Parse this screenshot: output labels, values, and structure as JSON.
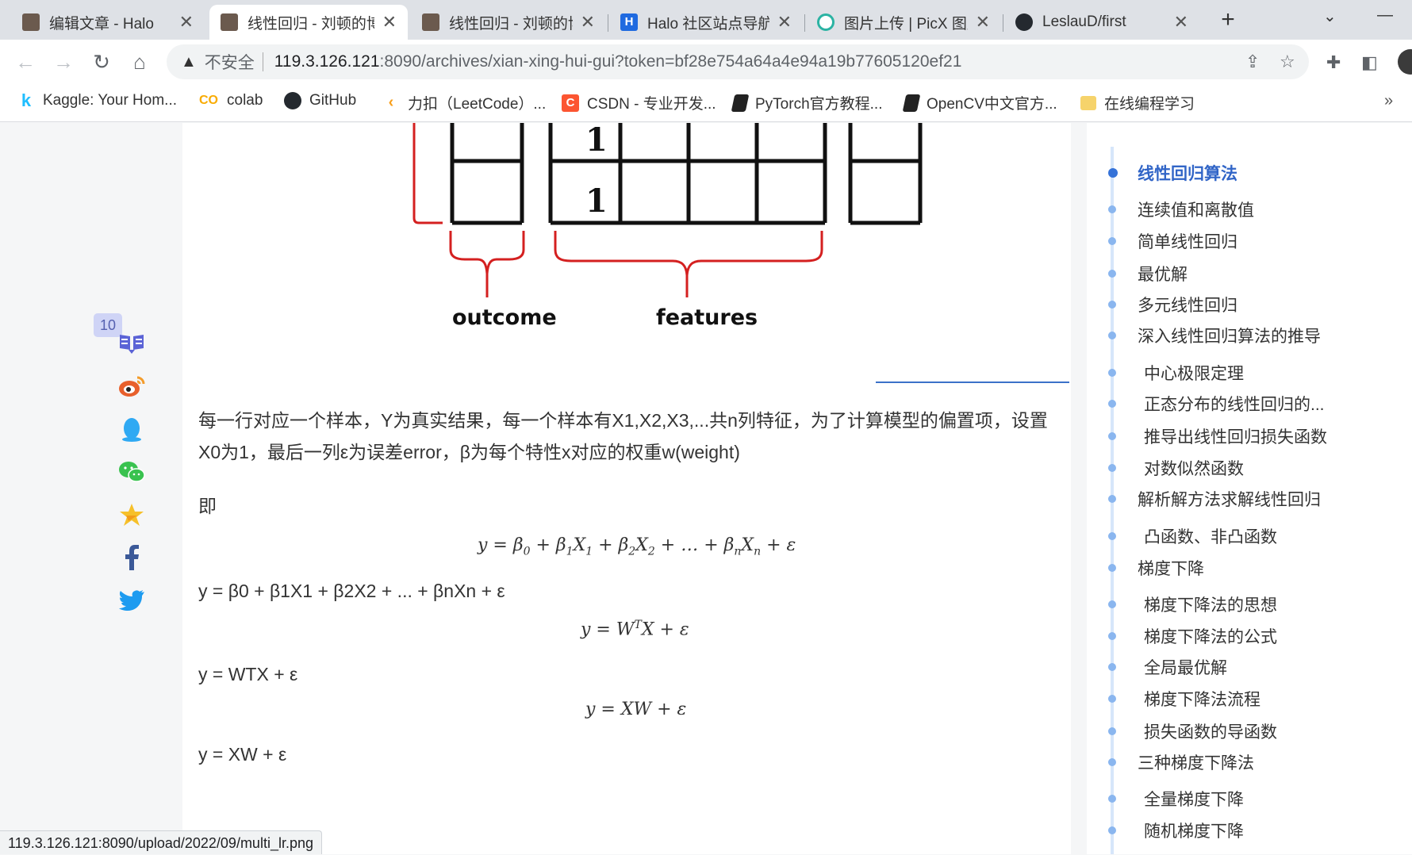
{
  "browser": {
    "tabs": [
      {
        "title": "编辑文章 - Halo"
      },
      {
        "title": "线性回归 - 刘顿的博"
      },
      {
        "title": "线性回归 - 刘顿的博"
      },
      {
        "title": "Halo 社区站点导航"
      },
      {
        "title": "图片上传 | PicX 图床"
      },
      {
        "title": "LeslauD/first"
      }
    ],
    "security_label": "不安全",
    "url_host": "119.3.126.121",
    "url_rest": ":8090/archives/xian-xing-hui-gui?token=bf28e754a64a4e94a19b77605120ef21",
    "bookmarks": [
      {
        "label": "Kaggle: Your Hom..."
      },
      {
        "label": "colab"
      },
      {
        "label": "GitHub"
      },
      {
        "label": "力扣（LeetCode）..."
      },
      {
        "label": "CSDN - 专业开发..."
      },
      {
        "label": "PyTorch官方教程..."
      },
      {
        "label": "OpenCV中文官方..."
      },
      {
        "label": "在线编程学习"
      }
    ],
    "bookmarks_overflow": "»",
    "status_url": "119.3.126.121:8090/upload/2022/09/multi_lr.png"
  },
  "share": {
    "comment_count": "10",
    "icons": [
      "comment-icon",
      "weibo-icon",
      "qq-icon",
      "wechat-icon",
      "qzone-icon",
      "facebook-icon",
      "twitter-icon"
    ]
  },
  "figure": {
    "cells": [
      "1",
      "1"
    ],
    "outcome_label": "outcome",
    "features_label": "features"
  },
  "article": {
    "para1_line1": "每一行对应一个样本，Y为真实结果，每一个样本有X1,X2,X3,...共n列特征，为了计算模型的偏置项，设置",
    "para1_line2": "X0为1，最后一列ε为误差error，β为每个特性x对应的权重w(weight)",
    "para2": "即",
    "formula1_alt": "y = β0 + β1X1 + β2X2 + ... + βnXn + ε",
    "formula2_alt": "y = WTX + ε",
    "formula3_alt": "y = XW + ε"
  },
  "toc": {
    "items": [
      {
        "label": "线性回归算法",
        "level": 0
      },
      {
        "label": "连续值和离散值",
        "level": 1
      },
      {
        "label": "简单线性回归",
        "level": 1
      },
      {
        "label": "最优解",
        "level": 1
      },
      {
        "label": "多元线性回归",
        "level": 1
      },
      {
        "label": "深入线性回归算法的推导",
        "level": 1
      },
      {
        "label": "中心极限定理",
        "level": 2
      },
      {
        "label": "正态分布的线性回归的...",
        "level": 2
      },
      {
        "label": "推导出线性回归损失函数",
        "level": 2
      },
      {
        "label": "对数似然函数",
        "level": 2
      },
      {
        "label": "解析解方法求解线性回归",
        "level": 1
      },
      {
        "label": "凸函数、非凸函数",
        "level": 2
      },
      {
        "label": "梯度下降",
        "level": 1
      },
      {
        "label": "梯度下降法的思想",
        "level": 2
      },
      {
        "label": "梯度下降法的公式",
        "level": 2
      },
      {
        "label": "全局最优解",
        "level": 2
      },
      {
        "label": "梯度下降法流程",
        "level": 2
      },
      {
        "label": "损失函数的导函数",
        "level": 2
      },
      {
        "label": "三种梯度下降法",
        "level": 1
      },
      {
        "label": "全量梯度下降",
        "level": 2
      },
      {
        "label": "随机梯度下降",
        "level": 2
      }
    ]
  },
  "colors": {
    "accent": "#3165c7",
    "toc_dot": "#8ab6ef",
    "bracket_red": "#d42020"
  }
}
